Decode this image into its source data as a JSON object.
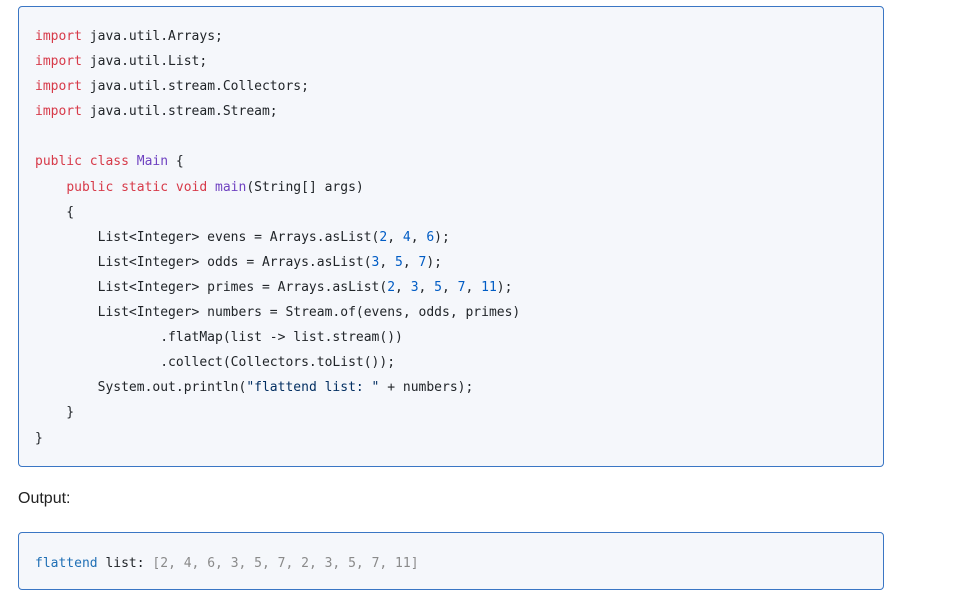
{
  "code": {
    "lines": [
      [
        {
          "t": "import",
          "c": "kw"
        },
        {
          "t": " java.util.Arrays;"
        }
      ],
      [
        {
          "t": "import",
          "c": "kw"
        },
        {
          "t": " java.util.List;"
        }
      ],
      [
        {
          "t": "import",
          "c": "kw"
        },
        {
          "t": " java.util.stream.Collectors;"
        }
      ],
      [
        {
          "t": "import",
          "c": "kw"
        },
        {
          "t": " java.util.stream.Stream;"
        }
      ],
      [],
      [
        {
          "t": "public class",
          "c": "kw"
        },
        {
          "t": " "
        },
        {
          "t": "Main",
          "c": "cls"
        },
        {
          "t": " {"
        }
      ],
      [
        {
          "t": "    "
        },
        {
          "t": "public static void",
          "c": "kw"
        },
        {
          "t": " "
        },
        {
          "t": "main",
          "c": "cls"
        },
        {
          "t": "(String[] args)"
        }
      ],
      [
        {
          "t": "    {"
        }
      ],
      [
        {
          "t": "        List<Integer> evens = Arrays.asList("
        },
        {
          "t": "2",
          "c": "num"
        },
        {
          "t": ", "
        },
        {
          "t": "4",
          "c": "num"
        },
        {
          "t": ", "
        },
        {
          "t": "6",
          "c": "num"
        },
        {
          "t": ");"
        }
      ],
      [
        {
          "t": "        List<Integer> odds = Arrays.asList("
        },
        {
          "t": "3",
          "c": "num"
        },
        {
          "t": ", "
        },
        {
          "t": "5",
          "c": "num"
        },
        {
          "t": ", "
        },
        {
          "t": "7",
          "c": "num"
        },
        {
          "t": ");"
        }
      ],
      [
        {
          "t": "        List<Integer> primes = Arrays.asList("
        },
        {
          "t": "2",
          "c": "num"
        },
        {
          "t": ", "
        },
        {
          "t": "3",
          "c": "num"
        },
        {
          "t": ", "
        },
        {
          "t": "5",
          "c": "num"
        },
        {
          "t": ", "
        },
        {
          "t": "7",
          "c": "num"
        },
        {
          "t": ", "
        },
        {
          "t": "11",
          "c": "num"
        },
        {
          "t": ");"
        }
      ],
      [
        {
          "t": "        List<Integer> numbers = Stream.of(evens, odds, primes)"
        }
      ],
      [
        {
          "t": "                .flatMap(list -> list.stream())"
        }
      ],
      [
        {
          "t": "                .collect(Collectors.toList());"
        }
      ],
      [
        {
          "t": "        System.out.println("
        },
        {
          "t": "\"flattend list: \"",
          "c": "str"
        },
        {
          "t": " + numbers);"
        }
      ],
      [
        {
          "t": "    }"
        }
      ],
      [
        {
          "t": "}"
        }
      ]
    ]
  },
  "output": {
    "label": "Output:",
    "key": "flattend",
    "word": " list: ",
    "value": "[2, 4, 6, 3, 5, 7, 2, 3, 5, 7, 11]"
  }
}
